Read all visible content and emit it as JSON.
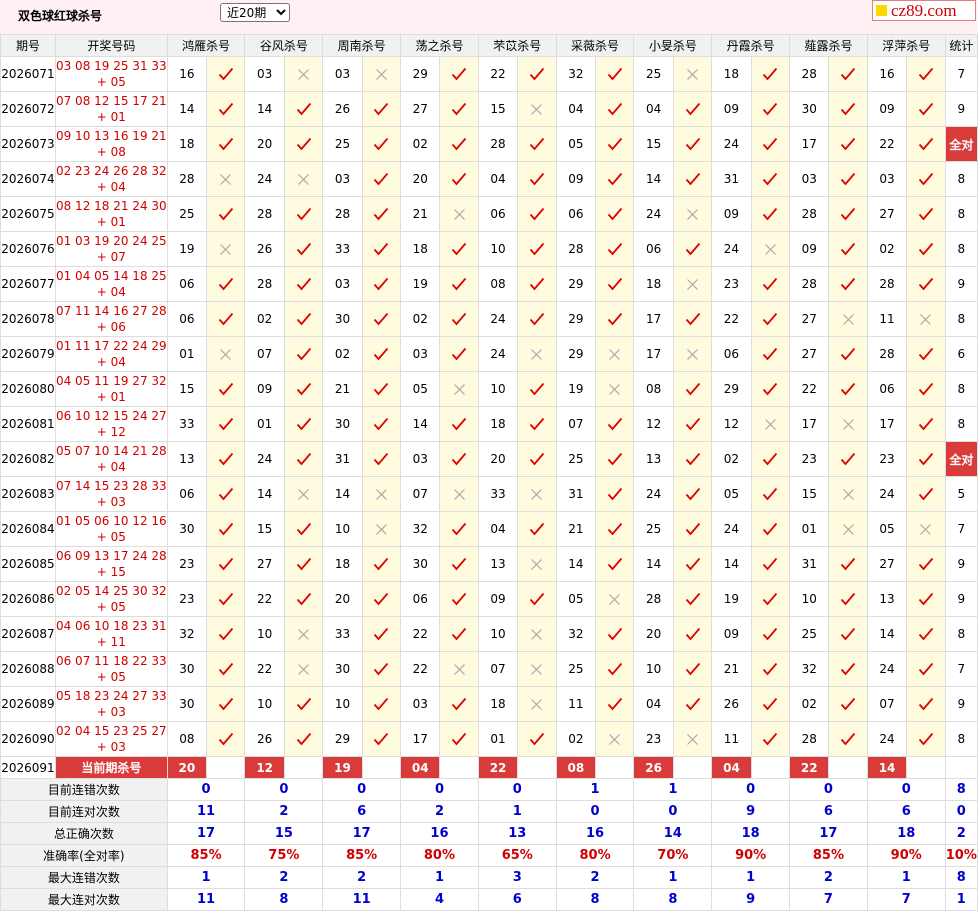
{
  "title": "双色球红球杀号",
  "period_select": "近20期",
  "logo": "cz89.com",
  "headers": [
    "期号",
    "开奖号码",
    "鸿雁杀号",
    "谷风杀号",
    "周南杀号",
    "荡之杀号",
    "芣苡杀号",
    "采薇杀号",
    "小旻杀号",
    "丹霞杀号",
    "薤露杀号",
    "浮萍杀号",
    "统计"
  ],
  "rows": [
    {
      "issue": "2026071",
      "red": "03 08 19 25 31 33",
      "blue": "+ 05",
      "kills": [
        "16",
        "03",
        "03",
        "29",
        "22",
        "32",
        "25",
        "18",
        "28",
        "16"
      ],
      "marks": [
        1,
        0,
        0,
        1,
        1,
        1,
        0,
        1,
        1,
        1
      ],
      "stat": "7"
    },
    {
      "issue": "2026072",
      "red": "07 08 12 15 17 21",
      "blue": "+ 01",
      "kills": [
        "14",
        "14",
        "26",
        "27",
        "15",
        "04",
        "04",
        "09",
        "30",
        "09"
      ],
      "marks": [
        1,
        1,
        1,
        1,
        0,
        1,
        1,
        1,
        1,
        1
      ],
      "stat": "9"
    },
    {
      "issue": "2026073",
      "red": "09 10 13 16 19 21",
      "blue": "+ 08",
      "kills": [
        "18",
        "20",
        "25",
        "02",
        "28",
        "05",
        "15",
        "24",
        "17",
        "22"
      ],
      "marks": [
        1,
        1,
        1,
        1,
        1,
        1,
        1,
        1,
        1,
        1
      ],
      "stat": "全对"
    },
    {
      "issue": "2026074",
      "red": "02 23 24 26 28 32",
      "blue": "+ 04",
      "kills": [
        "28",
        "24",
        "03",
        "20",
        "04",
        "09",
        "14",
        "31",
        "03",
        "03"
      ],
      "marks": [
        0,
        0,
        1,
        1,
        1,
        1,
        1,
        1,
        1,
        1
      ],
      "stat": "8"
    },
    {
      "issue": "2026075",
      "red": "08 12 18 21 24 30",
      "blue": "+ 01",
      "kills": [
        "25",
        "28",
        "28",
        "21",
        "06",
        "06",
        "24",
        "09",
        "28",
        "27"
      ],
      "marks": [
        1,
        1,
        1,
        0,
        1,
        1,
        0,
        1,
        1,
        1
      ],
      "stat": "8"
    },
    {
      "issue": "2026076",
      "red": "01 03 19 20 24 25",
      "blue": "+ 07",
      "kills": [
        "19",
        "26",
        "33",
        "18",
        "10",
        "28",
        "06",
        "24",
        "09",
        "02"
      ],
      "marks": [
        0,
        1,
        1,
        1,
        1,
        1,
        1,
        0,
        1,
        1
      ],
      "stat": "8"
    },
    {
      "issue": "2026077",
      "red": "01 04 05 14 18 25",
      "blue": "+ 04",
      "kills": [
        "06",
        "28",
        "03",
        "19",
        "08",
        "29",
        "18",
        "23",
        "28",
        "28"
      ],
      "marks": [
        1,
        1,
        1,
        1,
        1,
        1,
        0,
        1,
        1,
        1
      ],
      "stat": "9"
    },
    {
      "issue": "2026078",
      "red": "07 11 14 16 27 28",
      "blue": "+ 06",
      "kills": [
        "06",
        "02",
        "30",
        "02",
        "24",
        "29",
        "17",
        "22",
        "27",
        "11"
      ],
      "marks": [
        1,
        1,
        1,
        1,
        1,
        1,
        1,
        1,
        0,
        0
      ],
      "stat": "8"
    },
    {
      "issue": "2026079",
      "red": "01 11 17 22 24 29",
      "blue": "+ 04",
      "kills": [
        "01",
        "07",
        "02",
        "03",
        "24",
        "29",
        "17",
        "06",
        "27",
        "28"
      ],
      "marks": [
        0,
        1,
        1,
        1,
        0,
        0,
        0,
        1,
        1,
        1
      ],
      "stat": "6"
    },
    {
      "issue": "2026080",
      "red": "04 05 11 19 27 32",
      "blue": "+ 01",
      "kills": [
        "15",
        "09",
        "21",
        "05",
        "10",
        "19",
        "08",
        "29",
        "22",
        "06"
      ],
      "marks": [
        1,
        1,
        1,
        0,
        1,
        0,
        1,
        1,
        1,
        1
      ],
      "stat": "8"
    },
    {
      "issue": "2026081",
      "red": "06 10 12 15 24 27",
      "blue": "+ 12",
      "kills": [
        "33",
        "01",
        "30",
        "14",
        "18",
        "07",
        "12",
        "12",
        "17",
        "17"
      ],
      "marks": [
        1,
        1,
        1,
        1,
        1,
        1,
        1,
        0,
        0,
        1
      ],
      "stat": "8"
    },
    {
      "issue": "2026082",
      "red": "05 07 10 14 21 28",
      "blue": "+ 04",
      "kills": [
        "13",
        "24",
        "31",
        "03",
        "20",
        "25",
        "13",
        "02",
        "23",
        "23"
      ],
      "marks": [
        1,
        1,
        1,
        1,
        1,
        1,
        1,
        1,
        1,
        1
      ],
      "stat": "全对"
    },
    {
      "issue": "2026083",
      "red": "07 14 15 23 28 33",
      "blue": "+ 03",
      "kills": [
        "06",
        "14",
        "14",
        "07",
        "33",
        "31",
        "24",
        "05",
        "15",
        "24"
      ],
      "marks": [
        1,
        0,
        0,
        0,
        0,
        1,
        1,
        1,
        0,
        1
      ],
      "stat": "5"
    },
    {
      "issue": "2026084",
      "red": "01 05 06 10 12 16",
      "blue": "+ 05",
      "kills": [
        "30",
        "15",
        "10",
        "32",
        "04",
        "21",
        "25",
        "24",
        "01",
        "05"
      ],
      "marks": [
        1,
        1,
        0,
        1,
        1,
        1,
        1,
        1,
        0,
        0
      ],
      "stat": "7"
    },
    {
      "issue": "2026085",
      "red": "06 09 13 17 24 28",
      "blue": "+ 15",
      "kills": [
        "23",
        "27",
        "18",
        "30",
        "13",
        "14",
        "14",
        "14",
        "31",
        "27"
      ],
      "marks": [
        1,
        1,
        1,
        1,
        0,
        1,
        1,
        1,
        1,
        1
      ],
      "stat": "9"
    },
    {
      "issue": "2026086",
      "red": "02 05 14 25 30 32",
      "blue": "+ 05",
      "kills": [
        "23",
        "22",
        "20",
        "06",
        "09",
        "05",
        "28",
        "19",
        "10",
        "13"
      ],
      "marks": [
        1,
        1,
        1,
        1,
        1,
        0,
        1,
        1,
        1,
        1
      ],
      "stat": "9"
    },
    {
      "issue": "2026087",
      "red": "04 06 10 18 23 31",
      "blue": "+ 11",
      "kills": [
        "32",
        "10",
        "33",
        "22",
        "10",
        "32",
        "20",
        "09",
        "25",
        "14"
      ],
      "marks": [
        1,
        0,
        1,
        1,
        0,
        1,
        1,
        1,
        1,
        1
      ],
      "stat": "8"
    },
    {
      "issue": "2026088",
      "red": "06 07 11 18 22 33",
      "blue": "+ 05",
      "kills": [
        "30",
        "22",
        "30",
        "22",
        "07",
        "25",
        "10",
        "21",
        "32",
        "24"
      ],
      "marks": [
        1,
        0,
        1,
        0,
        0,
        1,
        1,
        1,
        1,
        1
      ],
      "stat": "7"
    },
    {
      "issue": "2026089",
      "red": "05 18 23 24 27 33",
      "blue": "+ 03",
      "kills": [
        "30",
        "10",
        "10",
        "03",
        "18",
        "11",
        "04",
        "26",
        "02",
        "07"
      ],
      "marks": [
        1,
        1,
        1,
        1,
        0,
        1,
        1,
        1,
        1,
        1
      ],
      "stat": "9"
    },
    {
      "issue": "2026090",
      "red": "02 04 15 23 25 27",
      "blue": "+ 03",
      "kills": [
        "08",
        "26",
        "29",
        "17",
        "01",
        "02",
        "23",
        "11",
        "28",
        "24"
      ],
      "marks": [
        1,
        1,
        1,
        1,
        1,
        0,
        0,
        1,
        1,
        1
      ],
      "stat": "8"
    }
  ],
  "current": {
    "issue": "2026091",
    "label": "当前期杀号",
    "kills": [
      "20",
      "12",
      "19",
      "04",
      "22",
      "08",
      "26",
      "04",
      "22",
      "14"
    ]
  },
  "summary": [
    {
      "label": "目前连错次数",
      "values": [
        "0",
        "0",
        "0",
        "0",
        "0",
        "1",
        "1",
        "0",
        "0",
        "0"
      ],
      "stat": "8",
      "color": "blue"
    },
    {
      "label": "目前连对次数",
      "values": [
        "11",
        "2",
        "6",
        "2",
        "1",
        "0",
        "0",
        "9",
        "6",
        "6"
      ],
      "stat": "0",
      "color": "blue"
    },
    {
      "label": "总正确次数",
      "values": [
        "17",
        "15",
        "17",
        "16",
        "13",
        "16",
        "14",
        "18",
        "17",
        "18"
      ],
      "stat": "2",
      "color": "blue"
    },
    {
      "label": "准确率(全对率)",
      "values": [
        "85%",
        "75%",
        "85%",
        "80%",
        "65%",
        "80%",
        "70%",
        "90%",
        "85%",
        "90%"
      ],
      "stat": "10%",
      "color": "red"
    },
    {
      "label": "最大连错次数",
      "values": [
        "1",
        "2",
        "2",
        "1",
        "3",
        "2",
        "1",
        "1",
        "2",
        "1"
      ],
      "stat": "8",
      "color": "blue"
    },
    {
      "label": "最大连对次数",
      "values": [
        "11",
        "8",
        "11",
        "4",
        "6",
        "8",
        "8",
        "9",
        "7",
        "7"
      ],
      "stat": "1",
      "color": "blue"
    }
  ],
  "colors": {
    "hit": "#e00000",
    "miss": "#a8a8a8",
    "all_bg": "#d93b3b"
  },
  "icons": {
    "hit": "check-icon",
    "miss": "cross-icon"
  }
}
